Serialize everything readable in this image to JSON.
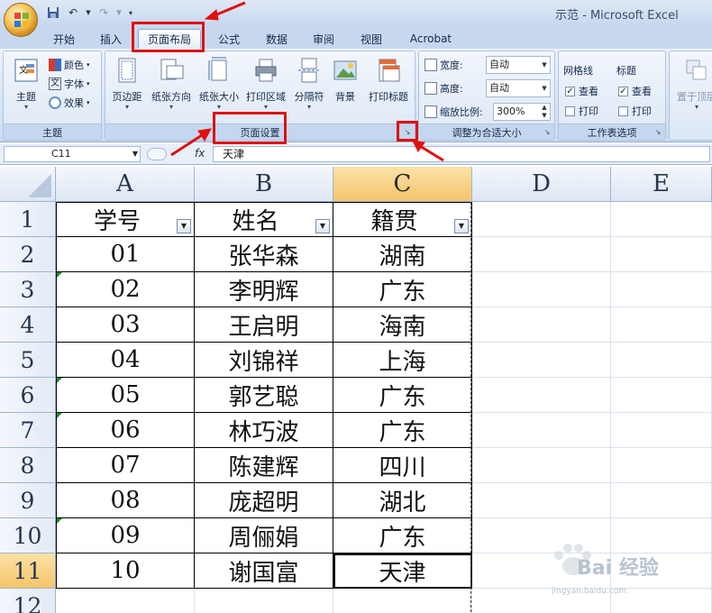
{
  "window": {
    "title": "示范 - Microsoft Excel"
  },
  "ribbon_tabs": [
    {
      "label": "开始",
      "active": false
    },
    {
      "label": "插入",
      "active": false
    },
    {
      "label": "页面布局",
      "active": true
    },
    {
      "label": "公式",
      "active": false
    },
    {
      "label": "数据",
      "active": false
    },
    {
      "label": "审阅",
      "active": false
    },
    {
      "label": "视图",
      "active": false
    },
    {
      "label": "Acrobat",
      "active": false
    }
  ],
  "groups": {
    "theme": {
      "label": "主题",
      "button": "主题",
      "colors": "颜色",
      "fonts": "字体",
      "effects": "效果"
    },
    "page_setup": {
      "label": "页面设置",
      "buttons": [
        "页边距",
        "纸张方向",
        "纸张大小",
        "打印区域",
        "分隔符",
        "背景",
        "打印标题"
      ]
    },
    "scale_to_fit": {
      "label": "调整为合适大小",
      "width_label": "宽度:",
      "width_value": "自动",
      "height_label": "高度:",
      "height_value": "自动",
      "scale_label": "缩放比例:",
      "scale_value": "300%"
    },
    "sheet_options": {
      "label": "工作表选项",
      "gridlines": "网格线",
      "headings": "标题",
      "view": "查看",
      "print": "打印",
      "gridlines_view": true,
      "gridlines_print": false,
      "headings_view": true,
      "headings_print": false
    },
    "arrange": {
      "button": "置于顶层"
    }
  },
  "formula_bar": {
    "name_box": "C11",
    "fx": "fx",
    "content": "天津"
  },
  "sheet": {
    "columns": [
      "A",
      "B",
      "C",
      "D",
      "E"
    ],
    "selected_column": "C",
    "selected_row": "11",
    "header": [
      "学号",
      "姓名",
      "籍贯"
    ],
    "rows": [
      {
        "num": "1"
      },
      {
        "num": "2",
        "cells": [
          "01",
          "张华森",
          "湖南"
        ]
      },
      {
        "num": "3",
        "cells": [
          "02",
          "李明辉",
          "广东"
        ]
      },
      {
        "num": "4",
        "cells": [
          "03",
          "王启明",
          "海南"
        ]
      },
      {
        "num": "5",
        "cells": [
          "04",
          "刘锦祥",
          "上海"
        ]
      },
      {
        "num": "6",
        "cells": [
          "05",
          "郭艺聪",
          "广东"
        ]
      },
      {
        "num": "7",
        "cells": [
          "06",
          "林巧波",
          "广东"
        ]
      },
      {
        "num": "8",
        "cells": [
          "07",
          "陈建辉",
          "四川"
        ]
      },
      {
        "num": "9",
        "cells": [
          "08",
          "庞超明",
          "湖北"
        ]
      },
      {
        "num": "10",
        "cells": [
          "09",
          "周俪娟",
          "广东"
        ]
      },
      {
        "num": "11",
        "cells": [
          "10",
          "谢国富",
          "天津"
        ]
      },
      {
        "num": "12"
      }
    ]
  },
  "watermark": {
    "brand": "Bai 经验",
    "url": "jingyan.baidu.com"
  },
  "colors": {
    "annotation_red": "#e01010",
    "selection_orange": "#f4c46a"
  }
}
